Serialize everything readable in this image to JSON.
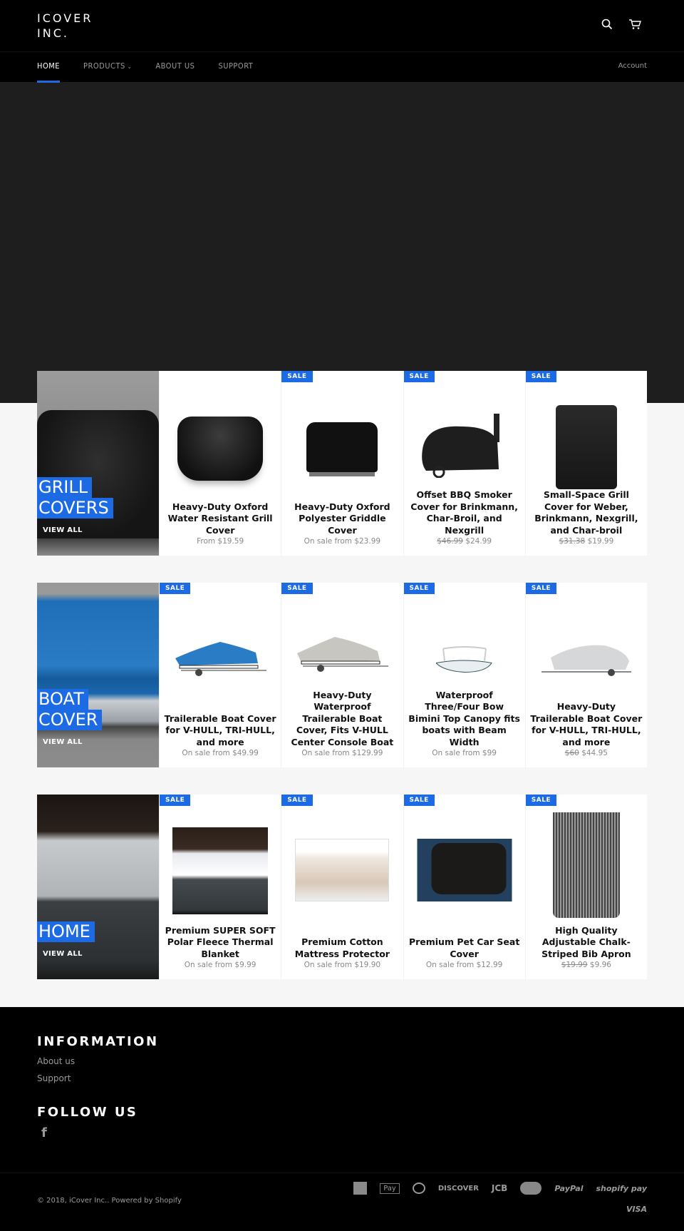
{
  "header": {
    "logo": "ICOVER INC.",
    "icons": {
      "search": "search-icon",
      "cart": "cart-icon"
    }
  },
  "nav": {
    "items": [
      {
        "label": "HOME",
        "active": true
      },
      {
        "label": "PRODUCTS",
        "has_dropdown": true
      },
      {
        "label": "ABOUT US"
      },
      {
        "label": "SUPPORT"
      }
    ],
    "account": "Account"
  },
  "colors": {
    "accent": "#1d6ae5",
    "header_bg": "#000000",
    "hero_bg": "#1e1e1e",
    "page_bg": "#f6f6f6"
  },
  "collections": [
    {
      "title_lines": [
        "GRILL",
        "COVERS"
      ],
      "view_all": "VIEW ALL",
      "products": [
        {
          "sale": false,
          "name": "Heavy-Duty Oxford Water Resistant Grill Cover",
          "price": "From $19.59"
        },
        {
          "sale": true,
          "sale_label": "SALE",
          "name": "Heavy-Duty Oxford Polyester Griddle Cover",
          "price": "On sale from $23.99"
        },
        {
          "sale": true,
          "sale_label": "SALE",
          "name": "Offset BBQ Smoker Cover for Brinkmann, Char-Broil, and Nexgrill",
          "compare_price": "$46.99",
          "price": "$24.99"
        },
        {
          "sale": true,
          "sale_label": "SALE",
          "name": "Small-Space Grill Cover for Weber, Brinkmann, Nexgrill, and Char-broil",
          "compare_price": "$31.38",
          "price": "$19.99"
        }
      ]
    },
    {
      "title_lines": [
        "BOAT",
        "COVER"
      ],
      "view_all": "VIEW ALL",
      "products": [
        {
          "sale": true,
          "sale_label": "SALE",
          "name": "Trailerable Boat Cover for V-HULL, TRI-HULL, and more",
          "price": "On sale from $49.99"
        },
        {
          "sale": true,
          "sale_label": "SALE",
          "name": "Heavy-Duty Waterproof Trailerable Boat Cover, Fits V-HULL Center Console Boat",
          "price": "On sale from $129.99"
        },
        {
          "sale": true,
          "sale_label": "SALE",
          "name": "Waterproof Three/Four Bow Bimini Top Canopy fits boats with Beam Width",
          "price": "On sale from $99"
        },
        {
          "sale": true,
          "sale_label": "SALE",
          "name": "Heavy-Duty Trailerable Boat Cover for V-HULL, TRI-HULL, and more",
          "compare_price": "$60",
          "price": "$44.95"
        }
      ]
    },
    {
      "title_lines": [
        "HOME"
      ],
      "view_all": "VIEW ALL",
      "products": [
        {
          "sale": true,
          "sale_label": "SALE",
          "name": "Premium SUPER SOFT Polar Fleece Thermal Blanket",
          "price": "On sale from $9.99"
        },
        {
          "sale": true,
          "sale_label": "SALE",
          "name": "Premium Cotton Mattress Protector",
          "price": "On sale from $19.90"
        },
        {
          "sale": true,
          "sale_label": "SALE",
          "name": "Premium Pet Car Seat Cover",
          "price": "On sale from $12.99"
        },
        {
          "sale": true,
          "sale_label": "SALE",
          "name": "High Quality Adjustable Chalk-Striped Bib Apron",
          "compare_price": "$19.99",
          "price": "$9.96"
        }
      ]
    }
  ],
  "footer": {
    "information_heading": "INFORMATION",
    "links": [
      "About us",
      "Support"
    ],
    "follow_heading": "FOLLOW US",
    "social": "facebook-icon",
    "copyright": "© 2018, iCover Inc.. Powered by Shopify",
    "payments": [
      "American Express",
      "Apple Pay",
      "Diners Club",
      "DISCOVER",
      "JCB",
      "Master Card",
      "PayPal",
      "shopify pay",
      "VISA"
    ]
  }
}
